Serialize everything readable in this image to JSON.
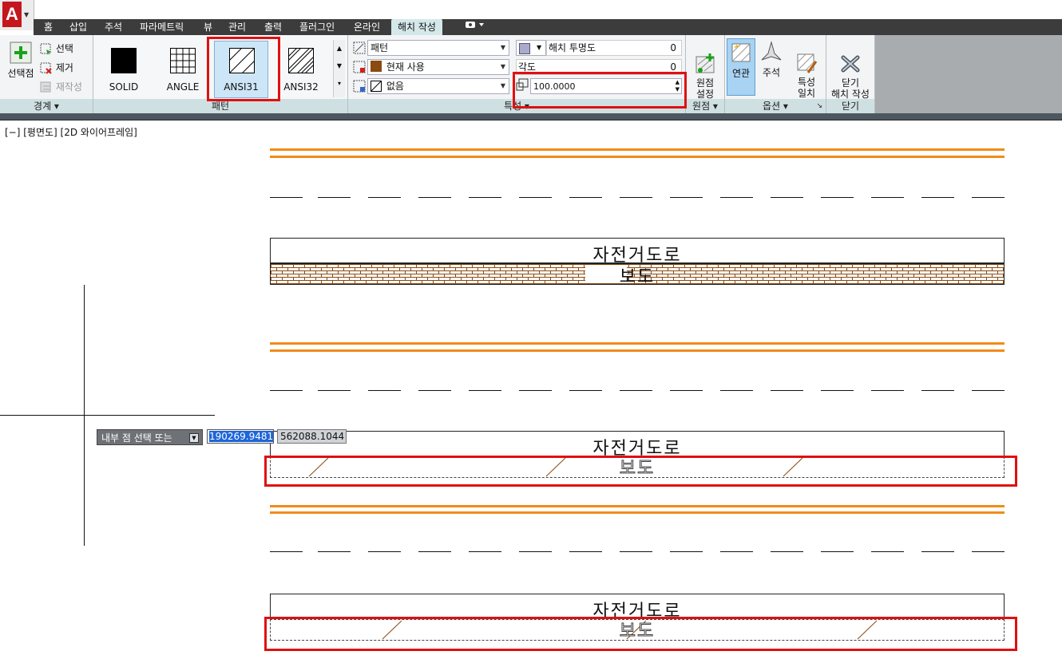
{
  "app": {
    "logo_letter": "A"
  },
  "tabs": [
    "홈",
    "삽입",
    "주석",
    "파라메트릭",
    "뷰",
    "관리",
    "출력",
    "플러그인",
    "온라인",
    "해치 작성"
  ],
  "active_tab": "해치 작성",
  "boundary_panel": {
    "pick_points_label": "선택점",
    "select_label": "선택",
    "remove_label": "제거",
    "recreate_label": "재작성",
    "title": "경계 ▾"
  },
  "pattern_panel": {
    "title": "패턴",
    "patterns": [
      "SOLID",
      "ANGLE",
      "ANSI31",
      "ANSI32"
    ],
    "selected": "ANSI31"
  },
  "properties_panel": {
    "title": "특성 ▾",
    "hatch_type": "패턴",
    "hatch_color": "현재 사용",
    "background_color": "없음",
    "transparency_label": "해치 투명도",
    "transparency_value": "0",
    "angle_label": "각도",
    "angle_value": "0",
    "scale_value": "100.0000"
  },
  "origin_panel": {
    "set_origin_label": "원점\n설정",
    "title": "원점 ▾"
  },
  "options_panel": {
    "associative_label": "연관",
    "annotative_label": "주석",
    "match_properties_label": "특성\n일치",
    "title": "옵션 ▾"
  },
  "close_panel": {
    "close_label": "닫기\n해치 작성",
    "title": "닫기"
  },
  "viewport": {
    "label": "[−] [평면도] [2D 와이어프레임]",
    "bike_road_label": "자전거도로",
    "sidewalk_label": "보도"
  },
  "command": {
    "prompt": "내부 점 선택 또는",
    "x_value": "190269.9481",
    "y_value": "562088.1044"
  },
  "colors": {
    "accent_orange": "#f28b1a",
    "highlight_red": "#e01010",
    "hatch_brown": "#8a4a10"
  }
}
